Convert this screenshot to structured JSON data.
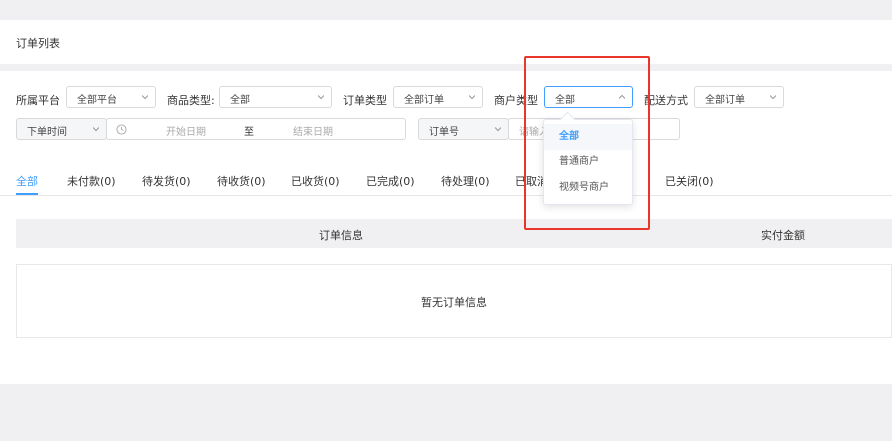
{
  "page": {
    "title": "订单列表"
  },
  "filters": {
    "platform": {
      "label": "所属平台",
      "value": "全部平台"
    },
    "product_type": {
      "label": "商品类型:",
      "value": "全部"
    },
    "order_type": {
      "label": "订单类型",
      "value": "全部订单"
    },
    "merchant_type": {
      "label": "商户类型",
      "value": "全部"
    },
    "delivery": {
      "label": "配送方式",
      "value": "全部订单"
    },
    "time_field": {
      "value": "下单时间"
    },
    "date_range": {
      "start_placeholder": "开始日期",
      "separator": "至",
      "end_placeholder": "结束日期"
    },
    "search_field": {
      "value": "订单号"
    },
    "search_input": {
      "placeholder": "请输入"
    }
  },
  "merchant_dropdown": {
    "options": [
      "全部",
      "普通商户",
      "视频号商户"
    ],
    "selected": "全部"
  },
  "tabs": [
    {
      "label": "全部"
    },
    {
      "label": "未付款(0)"
    },
    {
      "label": "待发货(0)"
    },
    {
      "label": "待收货(0)"
    },
    {
      "label": "已收货(0)"
    },
    {
      "label": "已完成(0)"
    },
    {
      "label": "待处理(0)"
    },
    {
      "label": "已取消(0)"
    },
    {
      "label": "已关闭(0)"
    }
  ],
  "table": {
    "columns": [
      "订单信息",
      "实付金额"
    ],
    "empty_text": "暂无订单信息"
  },
  "colors": {
    "accent": "#409eff",
    "highlight": "#e8362a"
  }
}
